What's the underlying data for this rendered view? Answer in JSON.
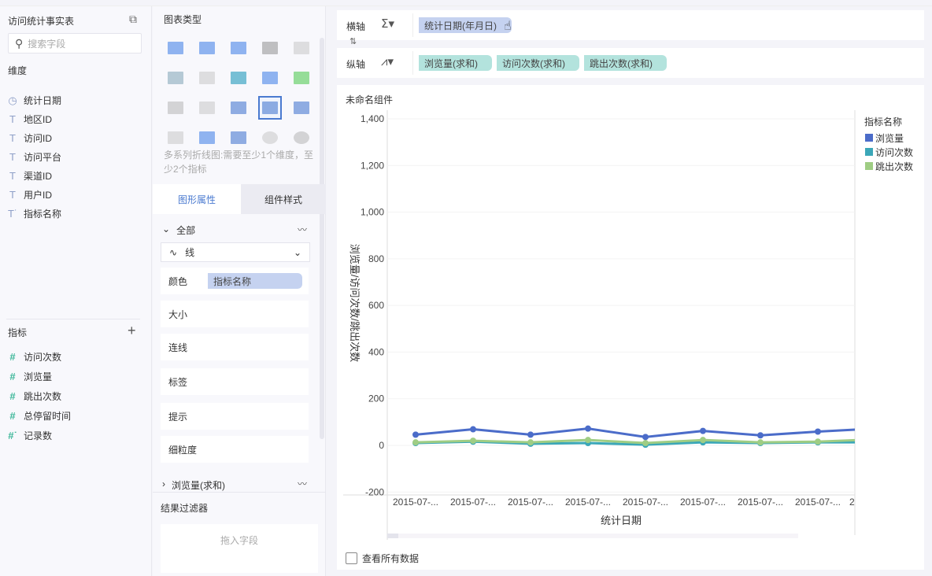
{
  "left": {
    "table_name": "访问统计事实表",
    "search_placeholder": "搜索字段",
    "dimensions_title": "维度",
    "dimensions": [
      {
        "icon": "clock-icon",
        "label": "统计日期"
      },
      {
        "icon": "text-icon",
        "label": "地区ID"
      },
      {
        "icon": "text-icon",
        "label": "访问ID"
      },
      {
        "icon": "text-icon",
        "label": "访问平台"
      },
      {
        "icon": "text-icon",
        "label": "渠道ID"
      },
      {
        "icon": "text-icon",
        "label": "用户ID"
      },
      {
        "icon": "text-calc-icon",
        "label": "指标名称"
      }
    ],
    "measures_title": "指标",
    "measures": [
      {
        "icon": "hash-icon",
        "label": "访问次数"
      },
      {
        "icon": "hash-icon",
        "label": "浏览量"
      },
      {
        "icon": "hash-icon",
        "label": "跳出次数"
      },
      {
        "icon": "hash-icon",
        "label": "总停留时间"
      },
      {
        "icon": "hash-calc-icon",
        "label": "记录数"
      }
    ]
  },
  "mid": {
    "chart_type_title": "图表类型",
    "chart_types": [
      "table",
      "grouped-table",
      "cross-table",
      "kpi-number",
      "text-table",
      "legend-table",
      "heat-map",
      "stacked-bar",
      "grouped-bar",
      "bar",
      "matrix",
      "scatter-gray",
      "multi-area",
      "multi-line",
      "radar",
      "area",
      "combo",
      "scatter",
      "bubble",
      "pie"
    ],
    "selected_chart_type": "multi-line",
    "hint": "多系列折线图:需要至少1个维度，至少2个指标",
    "tabs": [
      "图形属性",
      "组件样式"
    ],
    "active_tab": 0,
    "all_label": "全部",
    "mark_type": "线",
    "props": {
      "color_label": "颜色",
      "color_field": "指标名称",
      "size": "大小",
      "connect": "连线",
      "label": "标签",
      "tooltip": "提示",
      "granularity": "细粒度"
    },
    "series_section": "浏览量(求和)",
    "filter_title": "结果过滤器",
    "filter_placeholder": "拖入字段"
  },
  "shelf": {
    "x_label": "横轴",
    "y_label": "纵轴",
    "x_fields": [
      "统计日期(年月日)"
    ],
    "y_fields": [
      "浏览量(求和)",
      "访问次数(求和)",
      "跳出次数(求和)"
    ]
  },
  "component": {
    "title": "未命名组件",
    "show_all": "查看所有数据",
    "show_all_checked": false
  },
  "chart_data": {
    "type": "line",
    "xlabel": "统计日期",
    "ylabel": "浏览量/访问次数/跳出次数",
    "categories": [
      "2015-07-...",
      "2015-07-...",
      "2015-07-...",
      "2015-07-...",
      "2015-07-...",
      "2015-07-...",
      "2015-07-...",
      "2015-07-...",
      "2"
    ],
    "yticks": [
      "1,400",
      "1,200",
      "1,000",
      "800",
      "600",
      "400",
      "200",
      "0",
      "-200"
    ],
    "ylim": [
      -230,
      1400
    ],
    "legend_title": "指标名称",
    "legend_position": "right",
    "series": [
      {
        "name": "浏览量",
        "color": "#4b6cc9",
        "values": [
          46,
          69,
          46,
          72,
          36,
          62,
          43,
          59,
          72
        ]
      },
      {
        "name": "访问次数",
        "color": "#3ba7b8",
        "values": [
          10,
          16,
          7,
          10,
          3,
          13,
          10,
          13,
          13
        ]
      },
      {
        "name": "跳出次数",
        "color": "#9fcd84",
        "values": [
          13,
          20,
          13,
          23,
          10,
          23,
          13,
          16,
          26
        ]
      }
    ]
  }
}
